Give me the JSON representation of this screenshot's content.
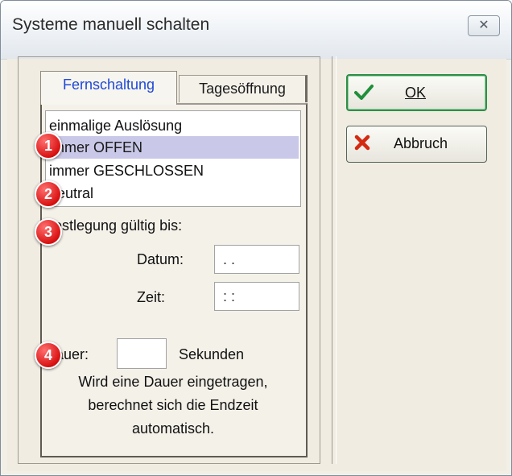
{
  "window": {
    "title": "Systeme manuell schalten",
    "close_glyph": "✕"
  },
  "tabs": [
    {
      "label": "Fernschaltung",
      "active": true
    },
    {
      "label": "Tagesöffnung",
      "active": false
    }
  ],
  "list": {
    "items": [
      {
        "label": "einmalige Auslösung",
        "selected": false
      },
      {
        "label": "immer OFFEN",
        "selected": true
      },
      {
        "label": "immer GESCHLOSSEN",
        "selected": false
      },
      {
        "label": "neutral",
        "selected": false
      }
    ]
  },
  "validity": {
    "heading": "Festlegung gültig bis:",
    "date_label": "Datum:",
    "date_value": ". .",
    "time_label": "Zeit:",
    "time_value": ": :"
  },
  "duration": {
    "label": "Dauer:",
    "value": "",
    "unit": "Sekunden",
    "note_line1": "Wird eine Dauer eingetragen,",
    "note_line2": "berechnet sich die Endzeit",
    "note_line3": "automatisch."
  },
  "buttons": {
    "ok_label": "OK",
    "ok_icon": "check-icon",
    "cancel_label": "Abbruch",
    "cancel_icon": "x-icon"
  },
  "badges": [
    "1",
    "2",
    "3",
    "4"
  ],
  "colors": {
    "accent_tab": "#1f49d6",
    "ok_border": "#2f8f49",
    "badge": "#d91212"
  }
}
